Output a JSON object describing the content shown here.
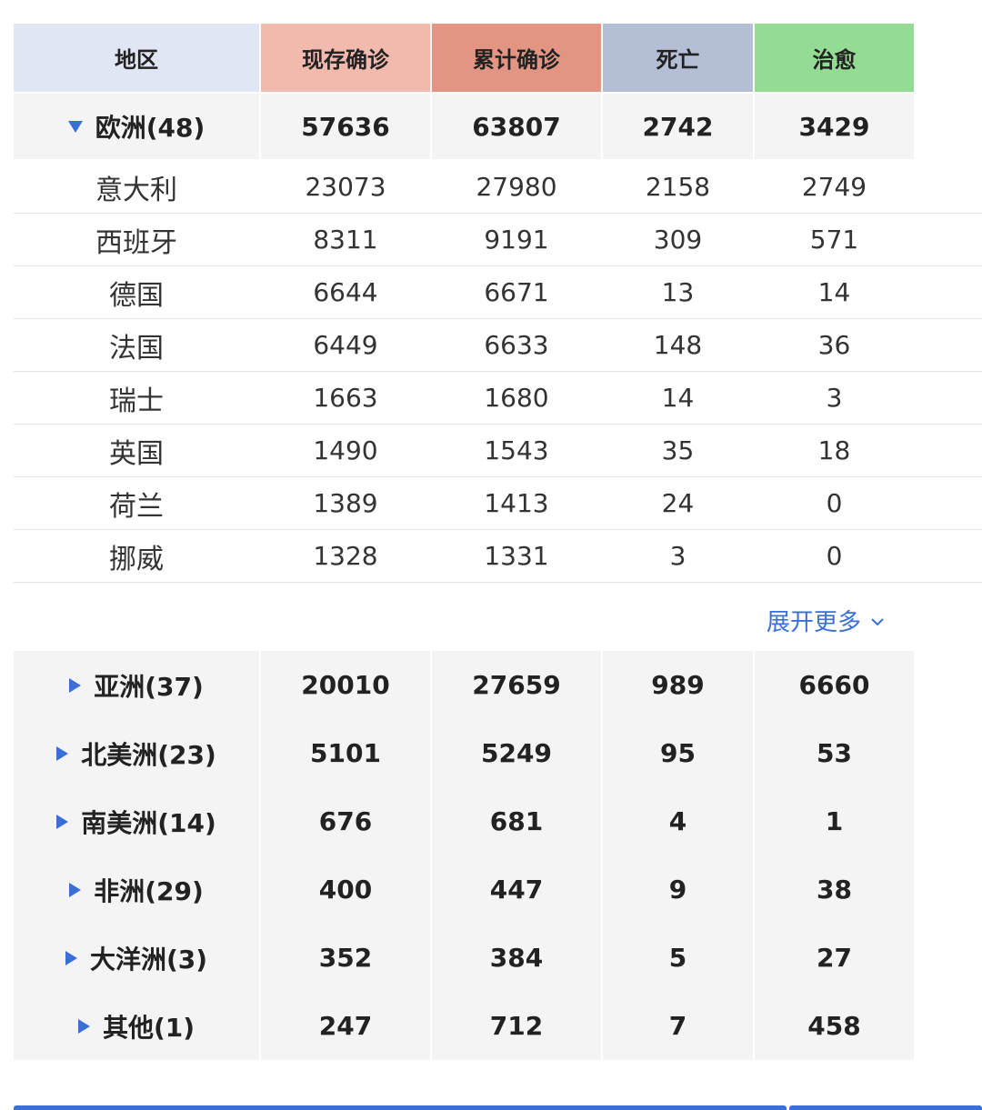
{
  "header": {
    "region": "地区",
    "current": "现存确诊",
    "total": "累计确诊",
    "deaths": "死亡",
    "healed": "治愈"
  },
  "colors": {
    "accent_blue": "#3b6fd8",
    "header_region": "#e0e6f4",
    "header_current": "#f2b9ad",
    "header_total": "#e39583",
    "header_deaths": "#b4bfd6",
    "header_healed": "#94dc94"
  },
  "europe": {
    "name": "欧洲(48)",
    "current": "57636",
    "total": "63807",
    "deaths": "2742",
    "healed": "3429",
    "expanded": true,
    "countries": [
      {
        "name": "意大利",
        "current": "23073",
        "total": "27980",
        "deaths": "2158",
        "healed": "2749"
      },
      {
        "name": "西班牙",
        "current": "8311",
        "total": "9191",
        "deaths": "309",
        "healed": "571"
      },
      {
        "name": "德国",
        "current": "6644",
        "total": "6671",
        "deaths": "13",
        "healed": "14"
      },
      {
        "name": "法国",
        "current": "6449",
        "total": "6633",
        "deaths": "148",
        "healed": "36"
      },
      {
        "name": "瑞士",
        "current": "1663",
        "total": "1680",
        "deaths": "14",
        "healed": "3"
      },
      {
        "name": "英国",
        "current": "1490",
        "total": "1543",
        "deaths": "35",
        "healed": "18"
      },
      {
        "name": "荷兰",
        "current": "1389",
        "total": "1413",
        "deaths": "24",
        "healed": "0"
      },
      {
        "name": "挪威",
        "current": "1328",
        "total": "1331",
        "deaths": "3",
        "healed": "0"
      }
    ]
  },
  "expand_more": {
    "label": "展开更多",
    "icon": "chevron-down-icon"
  },
  "continents": [
    {
      "name": "亚洲(37)",
      "current": "20010",
      "total": "27659",
      "deaths": "989",
      "healed": "6660"
    },
    {
      "name": "北美洲(23)",
      "current": "5101",
      "total": "5249",
      "deaths": "95",
      "healed": "53"
    },
    {
      "name": "南美洲(14)",
      "current": "676",
      "total": "681",
      "deaths": "4",
      "healed": "1"
    },
    {
      "name": "非洲(29)",
      "current": "400",
      "total": "447",
      "deaths": "9",
      "healed": "38"
    },
    {
      "name": "大洋洲(3)",
      "current": "352",
      "total": "384",
      "deaths": "5",
      "healed": "27"
    },
    {
      "name": "其他(1)",
      "current": "247",
      "total": "712",
      "deaths": "7",
      "healed": "458"
    }
  ]
}
